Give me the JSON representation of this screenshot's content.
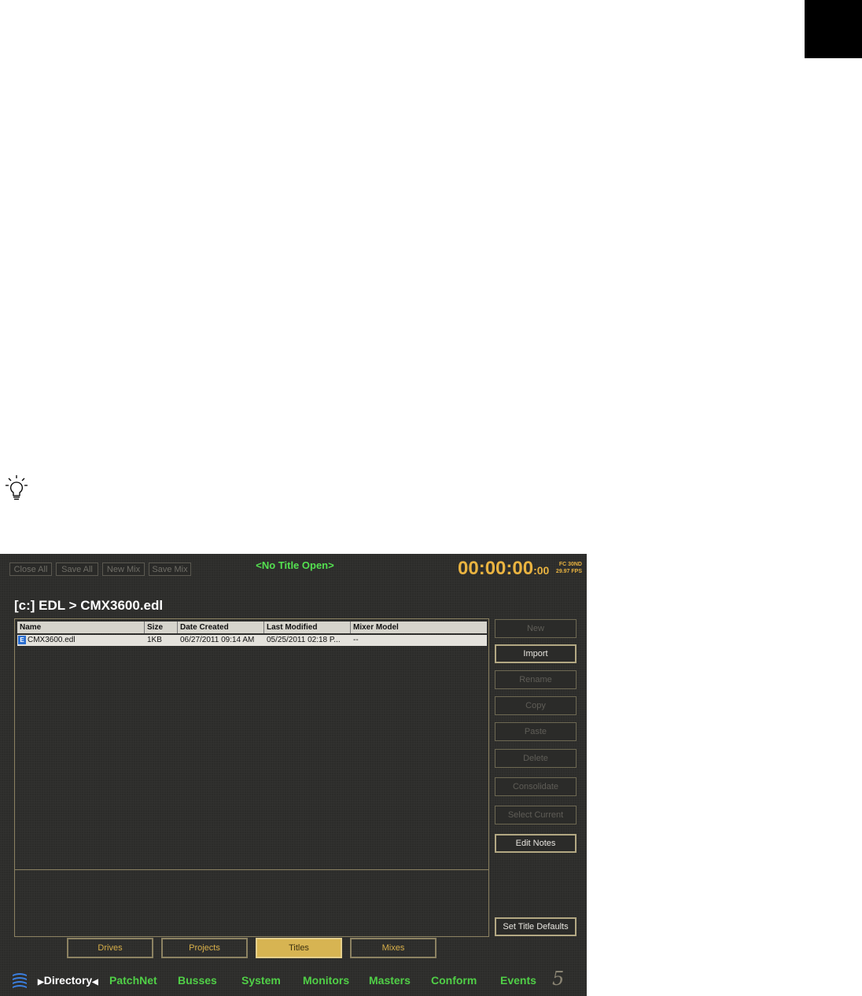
{
  "top_buttons": {
    "close_all": "Close All",
    "save_all": "Save All",
    "new_mix": "New Mix",
    "save_mix": "Save Mix"
  },
  "status": {
    "title": "<No Title Open>",
    "timecode_main": "00:00:00",
    "timecode_frames": ":00",
    "fps_line1": "FC 30ND",
    "fps_line2": "29.97 FPS"
  },
  "path": "[c:] EDL > CMX3600.edl",
  "table": {
    "columns": [
      "Name",
      "Size",
      "Date Created",
      "Last Modified",
      "Mixer Model"
    ],
    "rows": [
      {
        "icon": "E",
        "name": "CMX3600.edl",
        "size": "1KB",
        "created": "06/27/2011 09:14 AM",
        "modified": "05/25/2011 02:18 P...",
        "model": "--"
      }
    ]
  },
  "side_buttons": {
    "new": "New",
    "import": "Import",
    "rename": "Rename",
    "copy": "Copy",
    "paste": "Paste",
    "delete": "Delete",
    "consolidate": "Consolidate",
    "select_current": "Select Current",
    "edit_notes": "Edit Notes",
    "set_title_defaults": "Set Title Defaults"
  },
  "tabs": {
    "drives": "Drives",
    "projects": "Projects",
    "titles": "Titles",
    "mixes": "Mixes"
  },
  "nav": {
    "directory": "Directory",
    "patchnet": "PatchNet",
    "busses": "Busses",
    "system": "System",
    "monitors": "Monitors",
    "masters": "Masters",
    "conform": "Conform",
    "events": "Events"
  },
  "logo_text": "5",
  "colors": {
    "accent_gold": "#e9b340",
    "status_green": "#54e050",
    "nav_green": "#50cf47",
    "tab_selected": "#d7b452"
  }
}
